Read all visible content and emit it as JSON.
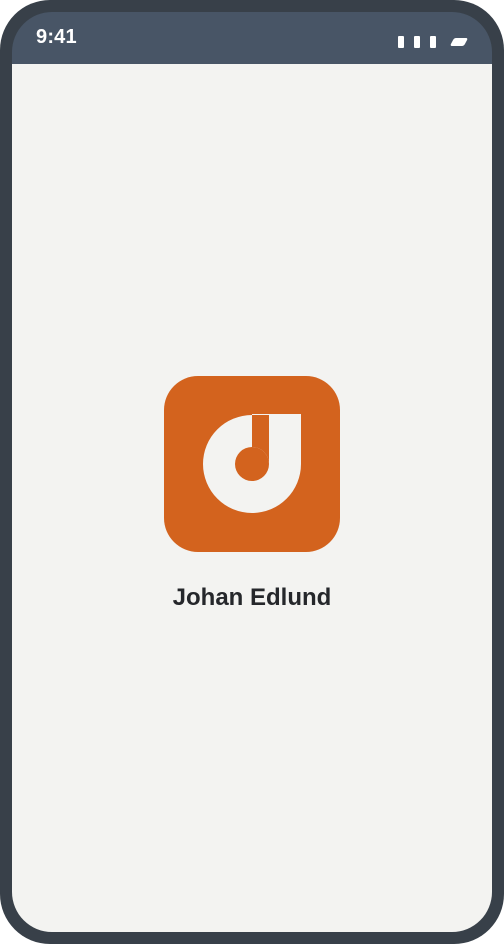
{
  "status_bar": {
    "time": "9:41",
    "signal_icon": "signal-bars-icon",
    "battery_icon": "battery-icon"
  },
  "app": {
    "name": "Johan Edlund",
    "icon": "music-note-d-logo-icon",
    "icon_color": "#d3631e",
    "icon_glyph_color": "#f3f3f1"
  },
  "colors": {
    "frame": "#384049",
    "status_bar": "#485566",
    "screen": "#f3f3f1",
    "text": "#25272b"
  }
}
